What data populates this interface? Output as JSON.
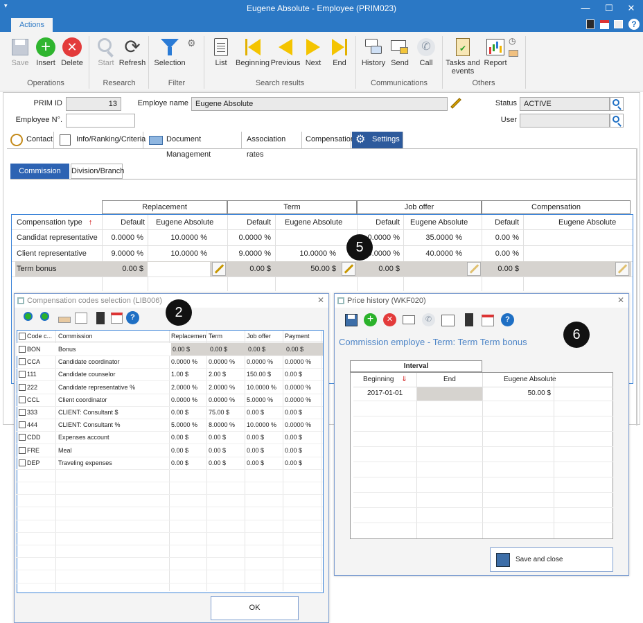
{
  "window": {
    "title": "Eugene Absolute - Employee (PRIM023)",
    "ribbon_tab": "Actions"
  },
  "ribbon": {
    "buttons": {
      "save": "Save",
      "insert": "Insert",
      "delete": "Delete",
      "start": "Start",
      "refresh": "Refresh",
      "selection": "Selection",
      "list": "List",
      "beginning": "Beginning",
      "previous": "Previous",
      "next": "Next",
      "end": "End",
      "history": "History",
      "send": "Send",
      "call": "Call",
      "tasks": "Tasks and events",
      "report": "Report"
    },
    "groups": {
      "operations": "Operations",
      "research": "Research",
      "filter": "Filter",
      "search_results": "Search results",
      "communications": "Communications",
      "others": "Others"
    }
  },
  "form": {
    "prim_id_label": "PRIM ID",
    "prim_id_value": "13",
    "employee_name_label": "Employe name",
    "employee_name_value": "Eugene Absolute",
    "status_label": "Status",
    "status_value": "ACTIVE",
    "employee_no_label": "Employee N°.",
    "employee_no_value": "",
    "user_label": "User",
    "user_value": ""
  },
  "tabs": [
    "Contact",
    "Info/Ranking/Criteria",
    "Document Management",
    "Association rates",
    "Compensation",
    "Settings"
  ],
  "subtabs": [
    "Commission rates",
    "Division/Branch"
  ],
  "rates": {
    "groups": [
      "Replacement",
      "Term",
      "Job offer",
      "Compensation"
    ],
    "type_header": "Compensation type",
    "sub": {
      "default": "Default",
      "person": "Eugene Absolute"
    },
    "rows": [
      {
        "type": "Candidat representative",
        "cells": [
          "0.0000 %",
          "10.0000 %",
          "0.0000 %",
          "",
          "0.0000 %",
          "35.0000 %",
          "0.00 %",
          ""
        ]
      },
      {
        "type": "Client representative",
        "cells": [
          "9.0000 %",
          "10.0000 %",
          "9.0000 %",
          "10.0000 %",
          "9.0000 %",
          "40.0000 %",
          "0.00 %",
          ""
        ]
      },
      {
        "type": "Term bonus",
        "cells": [
          "0.00 $",
          "",
          "0.00 $",
          "50.00 $",
          "0.00 $",
          "",
          "0.00 $",
          ""
        ]
      }
    ]
  },
  "codes_window": {
    "title": "Compensation codes selection (LIB006)",
    "headers": [
      "Code c...",
      "Commission",
      "Replacement",
      "Term",
      "Job offer",
      "Payment"
    ],
    "rows": [
      [
        "BON",
        "Bonus",
        "0.00 $",
        "0.00 $",
        "0.00 $",
        "0.00 $"
      ],
      [
        "CCA",
        "Candidate  coordinator",
        "0.0000 %",
        "0.0000 %",
        "0.0000 %",
        "0.0000 %"
      ],
      [
        "111",
        "Candidate counselor",
        "1.00 $",
        "2.00 $",
        "150.00 $",
        "0.00 $"
      ],
      [
        "222",
        "Candidate representative %",
        "2.0000 %",
        "2.0000 %",
        "10.0000 %",
        "0.0000 %"
      ],
      [
        "CCL",
        "Client coordinator",
        "0.0000 %",
        "0.0000 %",
        "5.0000 %",
        "0.0000 %"
      ],
      [
        "333",
        "CLIENT: Consultant $",
        "0.00 $",
        "75.00 $",
        "0.00 $",
        "0.00 $"
      ],
      [
        "444",
        "CLIENT: Consultant %",
        "5.0000 %",
        "8.0000 %",
        "10.0000 %",
        "0.0000 %"
      ],
      [
        "CDD",
        "Expenses account",
        "0.00 $",
        "0.00 $",
        "0.00 $",
        "0.00 $"
      ],
      [
        "FRE",
        "Meal",
        "0.00 $",
        "0.00 $",
        "0.00 $",
        "0.00 $"
      ],
      [
        "DEP",
        "Traveling expenses",
        "0.00 $",
        "0.00 $",
        "0.00 $",
        "0.00 $"
      ]
    ],
    "ok": "OK"
  },
  "price_window": {
    "title": "Price history (WKF020)",
    "heading": "Commission employe - Term: Term Term bonus",
    "interval": "Interval",
    "headers": [
      "Beginning",
      "End",
      "Eugene Absolute"
    ],
    "rows": [
      [
        "2017-01-01",
        "",
        "50.00 $"
      ]
    ],
    "save_close": "Save and close"
  },
  "callouts": [
    "2",
    "5",
    "6"
  ]
}
